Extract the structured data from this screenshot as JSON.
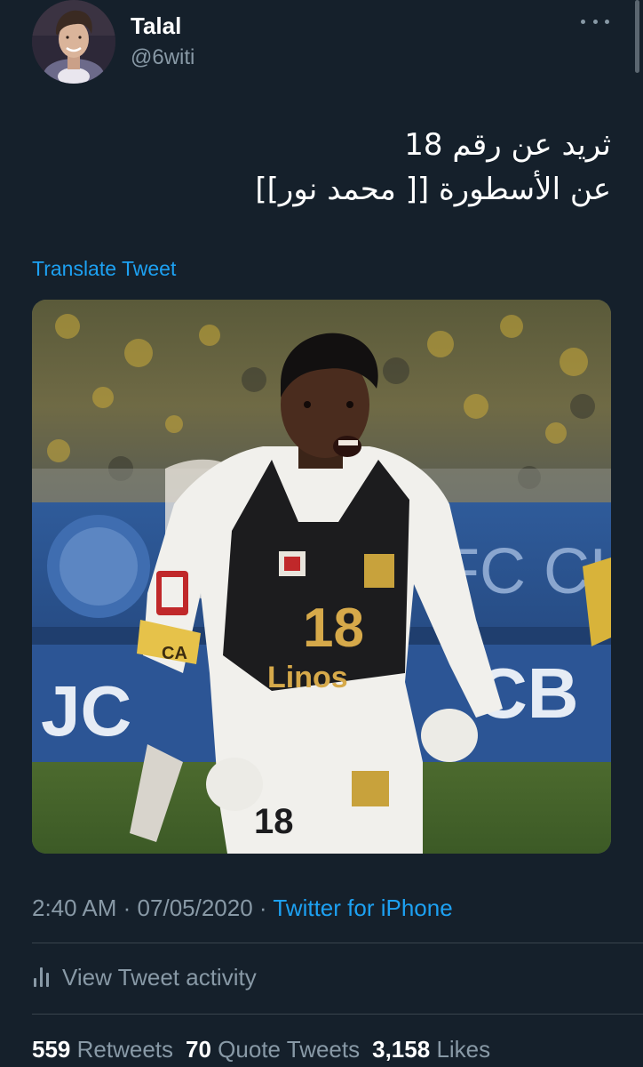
{
  "author": {
    "display_name": "Talal",
    "handle": "@6witi",
    "avatar_icon": "profile-photo"
  },
  "tweet": {
    "lines": [
      "ثريد عن رقم 18",
      "عن الأسطورة [[ محمد نور]]"
    ],
    "translate_label": "Translate Tweet",
    "media": {
      "jersey_number": "18",
      "banner_text_left": "JC",
      "banner_text_right": "CB",
      "banner_text_top": "FC CH",
      "sponsor": "Linos",
      "armband": "CA"
    }
  },
  "meta": {
    "time": "2:40 AM",
    "separator": "·",
    "date": "07/05/2020",
    "source": "Twitter for iPhone"
  },
  "activity": {
    "label": "View Tweet activity",
    "icon": "analytics-bars-icon"
  },
  "stats": {
    "retweets_count": "559",
    "retweets_label": "Retweets",
    "quotes_count": "70",
    "quotes_label": "Quote Tweets",
    "likes_count": "3,158",
    "likes_label": "Likes"
  },
  "colors": {
    "background": "#15202b",
    "link": "#1da1f2",
    "secondary_text": "#8899a6",
    "divider": "#38444d"
  }
}
